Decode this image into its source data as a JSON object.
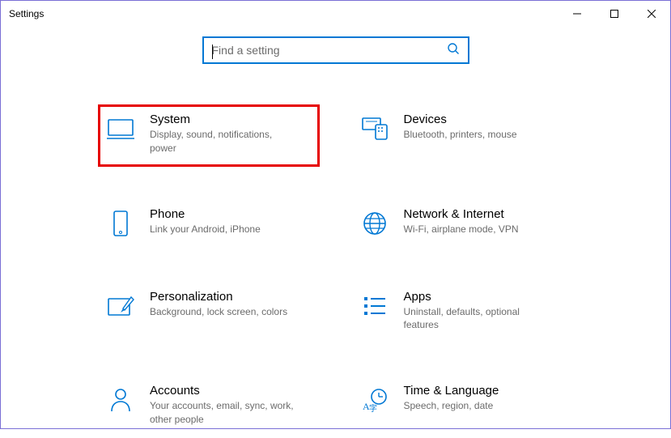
{
  "window": {
    "title": "Settings"
  },
  "search": {
    "placeholder": "Find a setting",
    "value": ""
  },
  "tiles": [
    {
      "id": "system",
      "label": "System",
      "desc": "Display, sound, notifications, power",
      "highlight": true
    },
    {
      "id": "devices",
      "label": "Devices",
      "desc": "Bluetooth, printers, mouse",
      "highlight": false
    },
    {
      "id": "phone",
      "label": "Phone",
      "desc": "Link your Android, iPhone",
      "highlight": false
    },
    {
      "id": "network",
      "label": "Network & Internet",
      "desc": "Wi-Fi, airplane mode, VPN",
      "highlight": false
    },
    {
      "id": "personalization",
      "label": "Personalization",
      "desc": "Background, lock screen, colors",
      "highlight": false
    },
    {
      "id": "apps",
      "label": "Apps",
      "desc": "Uninstall, defaults, optional features",
      "highlight": false
    },
    {
      "id": "accounts",
      "label": "Accounts",
      "desc": "Your accounts, email, sync, work, other people",
      "highlight": false
    },
    {
      "id": "time",
      "label": "Time & Language",
      "desc": "Speech, region, date",
      "highlight": false
    }
  ]
}
